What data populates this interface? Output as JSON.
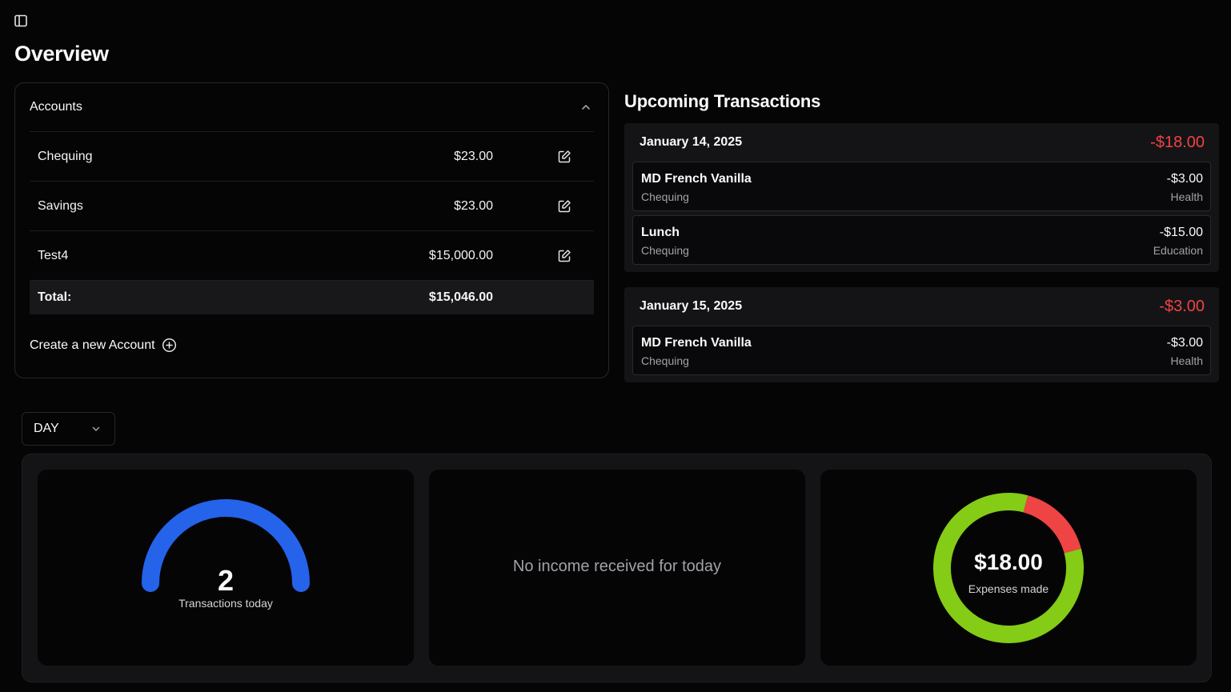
{
  "page": {
    "title": "Overview"
  },
  "accounts": {
    "title": "Accounts",
    "items": [
      {
        "name": "Chequing",
        "balance": "$23.00"
      },
      {
        "name": "Savings",
        "balance": "$23.00"
      },
      {
        "name": "Test4",
        "balance": "$15,000.00"
      }
    ],
    "total_label": "Total:",
    "total_value": "$15,046.00",
    "create_label": "Create a new Account"
  },
  "upcoming": {
    "title": "Upcoming Transactions",
    "days": [
      {
        "date": "January 14, 2025",
        "total": "-$18.00",
        "transactions": [
          {
            "name": "MD French Vanilla",
            "account": "Chequing",
            "amount": "-$3.00",
            "category": "Health"
          },
          {
            "name": "Lunch",
            "account": "Chequing",
            "amount": "-$15.00",
            "category": "Education"
          }
        ]
      },
      {
        "date": "January 15, 2025",
        "total": "-$3.00",
        "transactions": [
          {
            "name": "MD French Vanilla",
            "account": "Chequing",
            "amount": "-$3.00",
            "category": "Health"
          }
        ]
      }
    ]
  },
  "period": {
    "selected": "DAY"
  },
  "stats": {
    "transactions": {
      "count": "2",
      "label": "Transactions today",
      "gauge_fraction": 1.0,
      "color": "#2563eb"
    },
    "income": {
      "message": "No income received for today"
    },
    "expenses": {
      "amount": "$18.00",
      "label": "Expenses made",
      "segments": [
        {
          "category": "Education",
          "value": 15,
          "color": "#84cc16"
        },
        {
          "category": "Health",
          "value": 3,
          "color": "#ef4444"
        }
      ]
    }
  },
  "colors": {
    "negative": "#ef4444",
    "gauge": "#2563eb",
    "donut_primary": "#84cc16",
    "donut_secondary": "#ef4444"
  },
  "icons": {
    "sidebar_toggle": "panel-left-icon",
    "edit": "edit-icon",
    "collapse": "chevron-up-icon",
    "add": "plus-circle-icon",
    "dropdown": "chevron-down-icon"
  }
}
